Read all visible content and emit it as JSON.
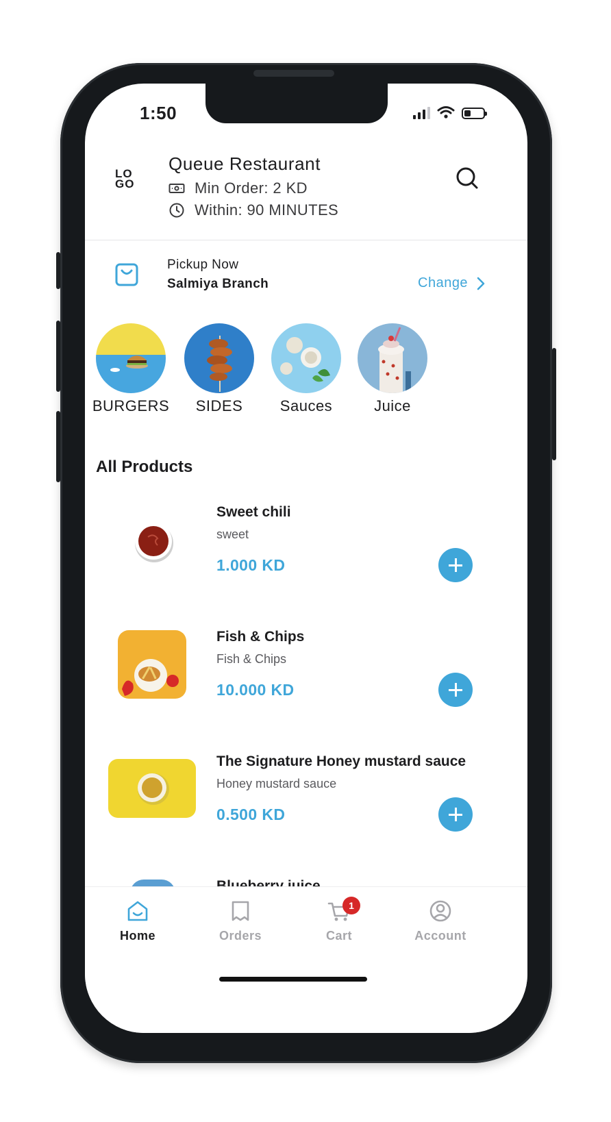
{
  "status_bar": {
    "time": "1:50"
  },
  "header": {
    "logo_top": "LO",
    "logo_bottom": "GO",
    "restaurant_name": "Queue Restaurant",
    "min_order": "Min Order: 2 KD",
    "within": "Within: 90 MINUTES"
  },
  "pickup": {
    "label": "Pickup Now",
    "branch": "Salmiya Branch",
    "change_label": "Change"
  },
  "categories": [
    {
      "label": "BURGERS"
    },
    {
      "label": "SIDES"
    },
    {
      "label": "Sauces"
    },
    {
      "label": "Juice"
    }
  ],
  "section_title": "All Products",
  "products": [
    {
      "name": "Sweet chili",
      "description": "sweet",
      "price": "1.000 KD"
    },
    {
      "name": "Fish &  Chips",
      "description": "Fish &  Chips",
      "price": "10.000 KD"
    },
    {
      "name": "The Signature Honey mustard sauce",
      "description": "Honey mustard sauce",
      "price": "0.500 KD"
    },
    {
      "name": "Blueberry juice"
    }
  ],
  "tabbar": {
    "tabs": [
      {
        "label": "Home",
        "icon": "home-icon",
        "active": true
      },
      {
        "label": "Orders",
        "icon": "orders-icon",
        "active": false
      },
      {
        "label": "Cart",
        "icon": "cart-icon",
        "active": false,
        "badge": "1"
      },
      {
        "label": "Account",
        "icon": "account-icon",
        "active": false
      }
    ]
  },
  "colors": {
    "accent": "#3fa6d9",
    "inactive_tab": "#a6a6aa",
    "badge": "#d62828"
  }
}
